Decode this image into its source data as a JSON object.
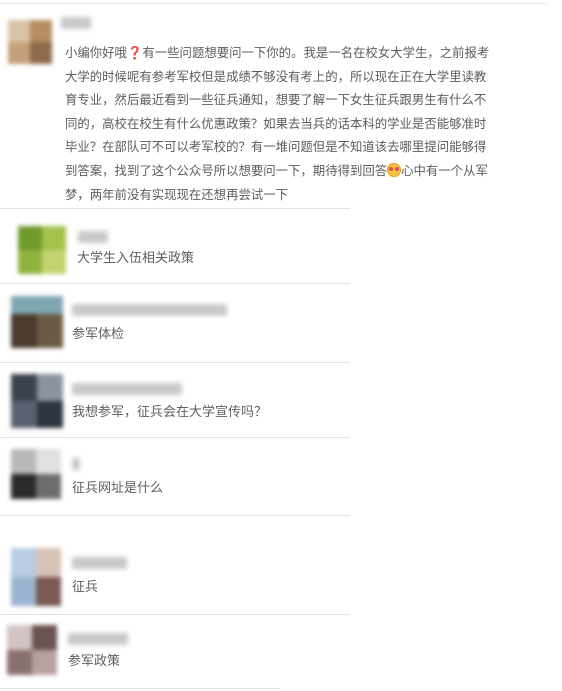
{
  "messages": [
    {
      "lines": [
        [
          "小编你好哦",
          "❓",
          "有一些问题想要问一下你的。我是一名在校女大学生，之前报考"
        ],
        [
          "大学的时候呢有参考军校但是成绩不够没有考上的，所以现在正在大学里读教"
        ],
        [
          "育专业，然后最近看到一些征兵通知，想要了解一下女生征兵跟男生有什么不"
        ],
        [
          "同的，高校在校生有什么优惠政策？如果去当兵的话本科的学业是否能够准时"
        ],
        [
          "毕业？在部队可不可以考军校的？有一堆问题但是不知道该去哪里提问能够得"
        ],
        [
          "到答案，找到了这个公众号所以想要问一下，期待得到回答",
          "😍",
          "心中有一个从军"
        ],
        [
          "梦，两年前没有实现现在还想再尝试一下"
        ]
      ],
      "emoji_icon": "smiling-face-with-heart-eyes-icon",
      "question_icon": "red-question-mark-icon"
    },
    {
      "text": "大学生入伍相关政策"
    },
    {
      "text": "参军体检"
    },
    {
      "text": "我想参军，征兵会在大学宣传吗？"
    },
    {
      "text": "征兵网址是什么"
    },
    {
      "text": "征兵"
    },
    {
      "text": "参军政策"
    }
  ]
}
